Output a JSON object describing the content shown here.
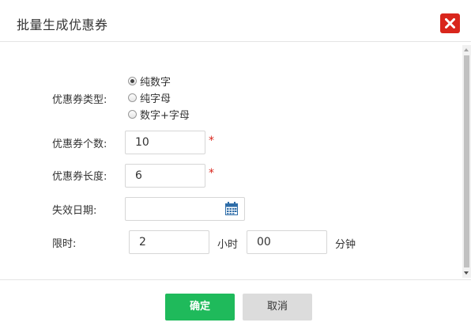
{
  "dialog": {
    "title": "批量生成优惠券",
    "close_icon": "close-icon"
  },
  "form": {
    "type_label": "优惠券类型:",
    "type_options": [
      {
        "label": "纯数字",
        "checked": true
      },
      {
        "label": "纯字母",
        "checked": false
      },
      {
        "label": "数字+字母",
        "checked": false
      }
    ],
    "count_label": "优惠券个数:",
    "count_value": "10",
    "length_label": "优惠券长度:",
    "length_value": "6",
    "required_mark": "*",
    "expire_label": "失效日期:",
    "expire_value": "",
    "expire_icon": "calendar-icon",
    "limit_label": "限时:",
    "hours_value": "2",
    "hours_unit": "小时",
    "minutes_value": "00",
    "minutes_unit": "分钟"
  },
  "footer": {
    "ok_label": "确定",
    "cancel_label": "取消"
  },
  "colors": {
    "close_bg": "#d9261c",
    "ok_bg": "#1fba5b",
    "cancel_bg": "#dcdcdc",
    "required": "#d9261c"
  }
}
